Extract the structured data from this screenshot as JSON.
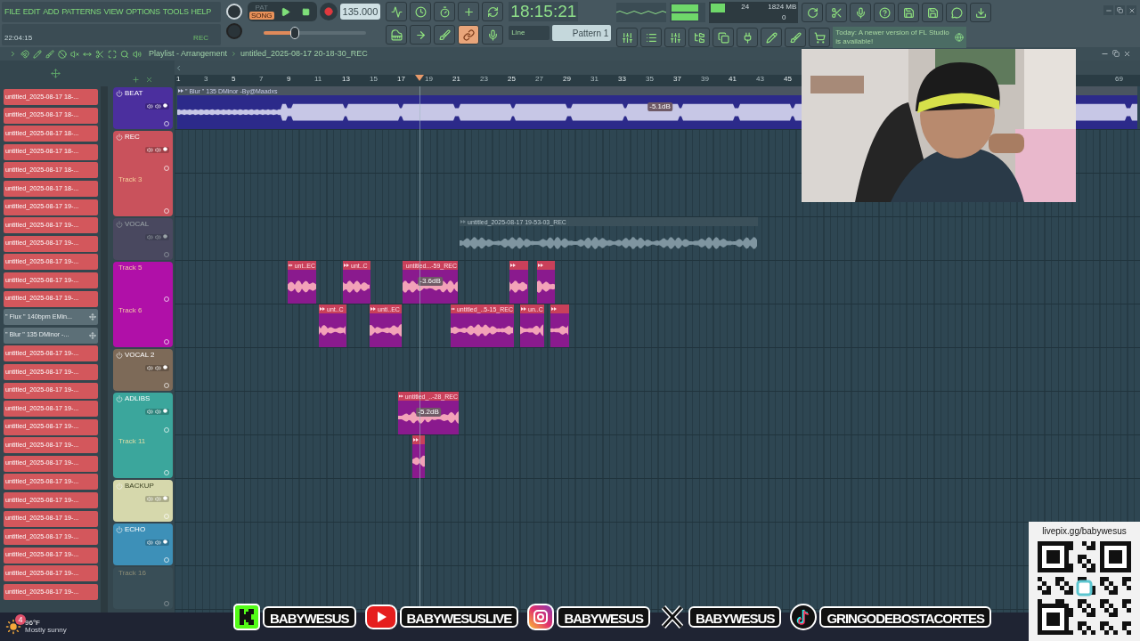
{
  "menu": [
    "FILE",
    "EDIT",
    "ADD",
    "PATTERNS",
    "VIEW",
    "OPTIONS",
    "TOOLS",
    "HELP"
  ],
  "hint_panel": {
    "time": "22:04:15",
    "label": "REC"
  },
  "transport": {
    "modes": [
      {
        "label": "PAT",
        "selected": false
      },
      {
        "label": "SONG",
        "selected": true
      }
    ],
    "tempo": "135.000",
    "master_slider": {
      "level": 0.3
    }
  },
  "link": {
    "on": true
  },
  "clock": "18:15:21",
  "snap": "Line",
  "pattern": "Pattern 1",
  "monitor": {
    "cpu": "24",
    "memory": "1824 MB",
    "polyphony": "0"
  },
  "news": {
    "label": "Today:",
    "text": "A newer version of FL Studio is available!"
  },
  "playlist": {
    "title": "Playlist - Arrangement",
    "file": "untitled_2025-08-17 20-18-30_REC",
    "ruler": [
      "1",
      "3",
      "5",
      "7",
      "9",
      "11",
      "13",
      "15",
      "17",
      "19",
      "21",
      "23",
      "25",
      "27",
      "29",
      "31",
      "33",
      "35",
      "37",
      "39",
      "41",
      "43",
      "45",
      "69"
    ],
    "browser": [
      {
        "kind": "audio",
        "label": "untitled_2025-08-17 18-..."
      },
      {
        "kind": "audio",
        "label": "untitled_2025-08-17 18-..."
      },
      {
        "kind": "audio",
        "label": "untitled_2025-08-17 18-..."
      },
      {
        "kind": "audio",
        "label": "untitled_2025-08-17 18-..."
      },
      {
        "kind": "audio",
        "label": "untitled_2025-08-17 18-..."
      },
      {
        "kind": "audio",
        "label": "untitled_2025-08-17 18-..."
      },
      {
        "kind": "audio",
        "label": "untitled_2025-08-17 19-..."
      },
      {
        "kind": "audio",
        "label": "untitled_2025-08-17 19-..."
      },
      {
        "kind": "audio",
        "label": "untitled_2025-08-17 19-..."
      },
      {
        "kind": "audio",
        "label": "untitled_2025-08-17 19-..."
      },
      {
        "kind": "audio",
        "label": "untitled_2025-08-17 19-..."
      },
      {
        "kind": "audio",
        "label": "untitled_2025-08-17 19-..."
      },
      {
        "kind": "pattern",
        "label": "\" Flux \" 140bpm EMin..."
      },
      {
        "kind": "pattern",
        "label": "\" Blur \" 135 DMinor -..."
      },
      {
        "kind": "audio",
        "label": "untitled_2025-08-17 19-..."
      },
      {
        "kind": "audio",
        "label": "untitled_2025-08-17 19-..."
      },
      {
        "kind": "audio",
        "label": "untitled_2025-08-17 19-..."
      },
      {
        "kind": "audio",
        "label": "untitled_2025-08-17 19-..."
      },
      {
        "kind": "audio",
        "label": "untitled_2025-08-17 19-..."
      },
      {
        "kind": "audio",
        "label": "untitled_2025-08-17 19-..."
      },
      {
        "kind": "audio",
        "label": "untitled_2025-08-17 19-..."
      },
      {
        "kind": "audio",
        "label": "untitled_2025-08-17 19-..."
      },
      {
        "kind": "audio",
        "label": "untitled_2025-08-17 19-..."
      },
      {
        "kind": "audio",
        "label": "untitled_2025-08-17 19-..."
      },
      {
        "kind": "audio",
        "label": "untitled_2025-08-17 19-..."
      },
      {
        "kind": "audio",
        "label": "untitled_2025-08-17 19-..."
      },
      {
        "kind": "audio",
        "label": "untitled_2025-08-17 19-..."
      },
      {
        "kind": "audio",
        "label": "untitled_2025-08-17 19-..."
      }
    ],
    "tracks": [
      {
        "color": "#4b2f9e",
        "titled": true,
        "dimmed": false,
        "lanes": [
          {
            "name": "BEAT",
            "clips": [
              {
                "kind": "beat",
                "label": "\" Blur \" 135 DMinor -By@Maadxs",
                "gain": "-5.1dB"
              }
            ]
          }
        ]
      },
      {
        "color": "#c9525c",
        "titled": true,
        "dimmed": false,
        "lanes": [
          {
            "name": "REC"
          },
          {
            "name": "Track 3"
          }
        ]
      },
      {
        "color": "#5e4a70",
        "titled": true,
        "dimmed": true,
        "lanes": [
          {
            "name": "VOCAL",
            "clips": [
              {
                "kind": "muted",
                "label": "untitled_2025-08-17 19-53-03_REC"
              }
            ]
          }
        ]
      },
      {
        "color": "#b010a8",
        "titled": false,
        "dimmed": false,
        "lanes": [
          {
            "name": "Track 5",
            "clips": [
              {
                "kind": "audio",
                "label": "unt..EC"
              },
              {
                "kind": "audio",
                "label": "unt..C"
              },
              {
                "kind": "audio",
                "label": "untitled...-59_REC",
                "gain": "-3.6dB"
              },
              {
                "kind": "audio"
              },
              {
                "kind": "audio"
              }
            ]
          },
          {
            "name": "Track 6",
            "clips": [
              {
                "kind": "audio",
                "label": "unt..C"
              },
              {
                "kind": "audio",
                "label": "unti..EC"
              },
              {
                "kind": "audio",
                "label": "untitled_..5-15_REC"
              },
              {
                "kind": "audio",
                "label": "un..C"
              },
              {
                "kind": "audio"
              }
            ]
          }
        ]
      },
      {
        "color": "#7d6a58",
        "titled": true,
        "dimmed": false,
        "lanes": [
          {
            "name": "VOCAL 2"
          }
        ]
      },
      {
        "color": "#3ba69c",
        "titled": true,
        "dimmed": false,
        "lanes": [
          {
            "name": "ADLIBS",
            "clips": [
              {
                "kind": "audio",
                "label": "untitled_..-28_REC",
                "gain": "-5.2dB"
              }
            ]
          },
          {
            "name": "Track 11",
            "clips": [
              {
                "kind": "audio"
              }
            ]
          }
        ]
      },
      {
        "color": "#d6d8ac",
        "titled": true,
        "dimmed": false,
        "lanes": [
          {
            "name": "BACKUP"
          }
        ]
      },
      {
        "color": "#3d90b8",
        "titled": true,
        "dimmed": false,
        "lanes": [
          {
            "name": "ECHO"
          }
        ]
      },
      {
        "color": "#3f5661",
        "titled": false,
        "dimmed": true,
        "lanes": [
          {
            "name": "Track 16"
          }
        ]
      }
    ]
  },
  "overlay": {
    "links": [
      {
        "kind": "kick",
        "handle": "BABYWESUS"
      },
      {
        "kind": "youtube",
        "handle": "BABYWESUSLIVE"
      },
      {
        "kind": "instagram",
        "handle": "BABYWESUS"
      },
      {
        "kind": "x",
        "handle": "BABYWESUS"
      },
      {
        "kind": "tiktok",
        "handle": "GRINGODEBOSTACORTES"
      }
    ],
    "qr": {
      "caption": "livepix.gg/babywesus"
    }
  },
  "taskbar": {
    "weather": {
      "badge": "4",
      "temp": "96°F",
      "condition": "Mostly sunny"
    }
  }
}
